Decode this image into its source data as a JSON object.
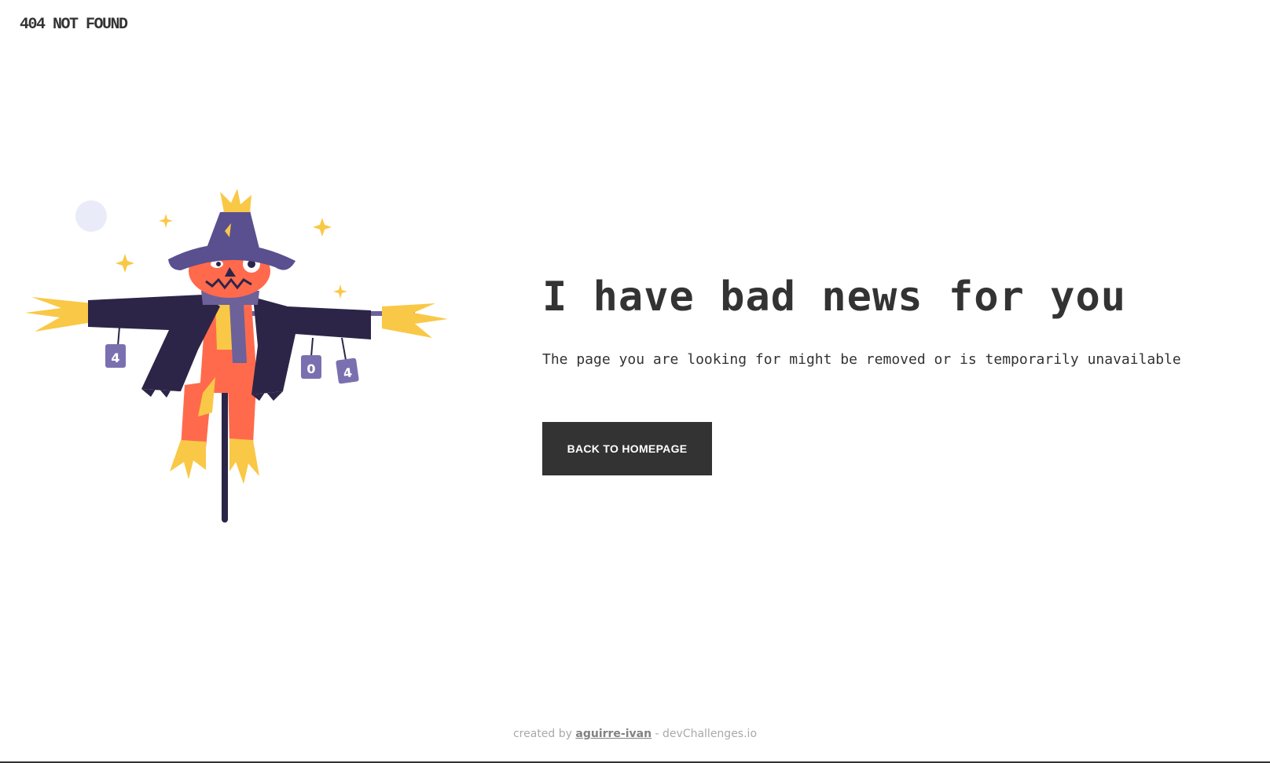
{
  "header": {
    "brand": "404 NOT FOUND"
  },
  "illustration": {
    "cans": [
      "4",
      "0",
      "4"
    ],
    "icons": [
      "moon-icon",
      "sparkle-icon"
    ],
    "colors": {
      "coat": "#2c2548",
      "hat": "#5a4f8f",
      "head": "#ff6a4d",
      "straw": "#f9c846",
      "scarf": "#6c6199",
      "can": "#7a70b0",
      "moon": "#e9ebf8"
    }
  },
  "main": {
    "headline": "I have bad news for you",
    "message": "The page you are looking for might be removed or is temporarily unavailable",
    "cta_label": "BACK TO HOMEPAGE"
  },
  "footer": {
    "prefix": "created by ",
    "author": "aguirre-ivan",
    "suffix": " - devChallenges.io"
  },
  "colors": {
    "text": "#333333",
    "button_bg": "#333333",
    "button_text": "#ffffff",
    "footer_text": "#a9a9a9",
    "background": "#ffffff"
  }
}
